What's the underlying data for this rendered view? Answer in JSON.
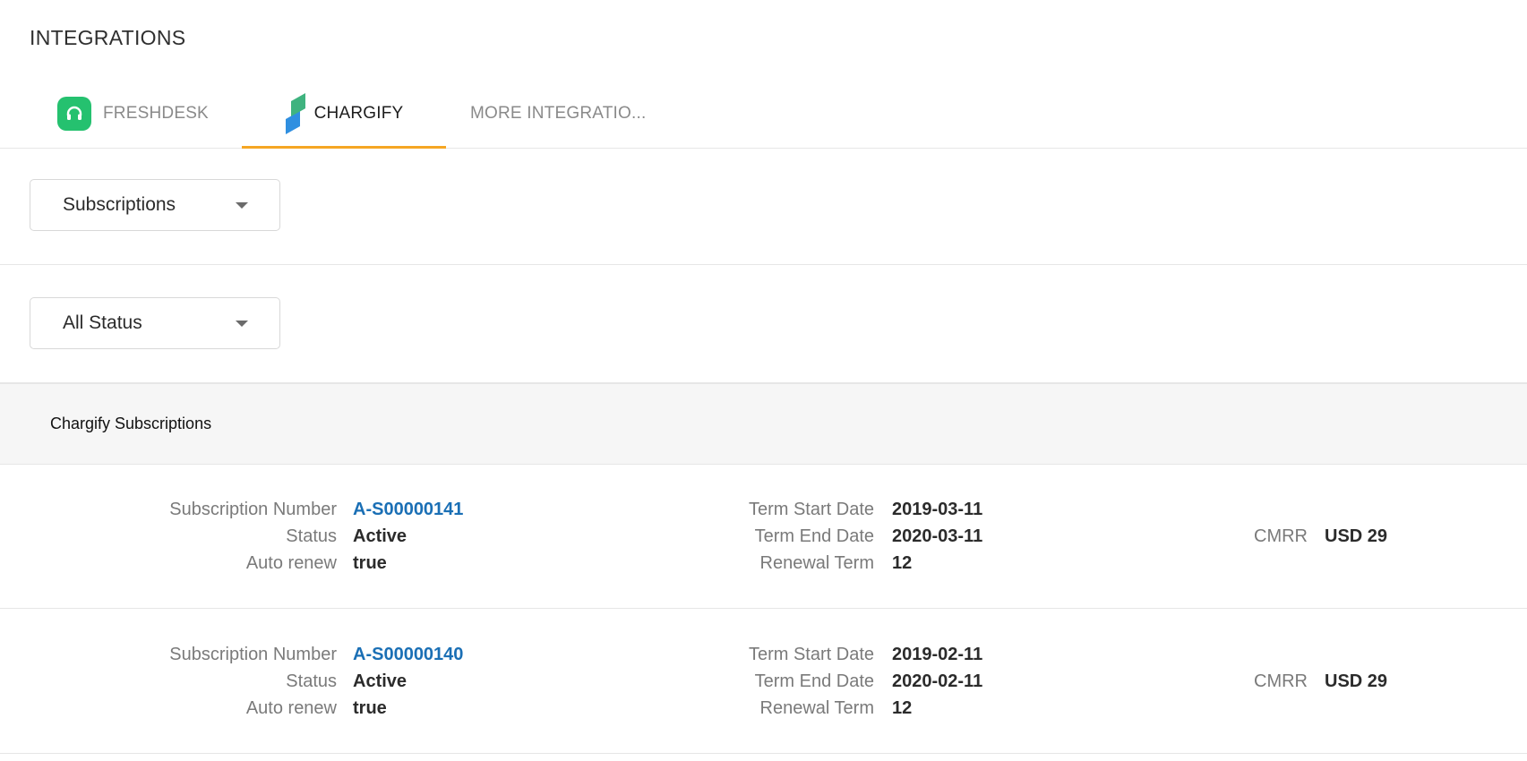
{
  "header": {
    "title": "INTEGRATIONS"
  },
  "tabs": [
    {
      "label": "FRESHDESK"
    },
    {
      "label": "CHARGIFY"
    },
    {
      "label": "MORE INTEGRATIO..."
    }
  ],
  "colors": {
    "active_tab_underline": "#f5a623",
    "link": "#1a6fb5",
    "freshdesk": "#25c16f"
  },
  "filters": {
    "type_select": {
      "value": "Subscriptions",
      "icon": "chevron-down-icon"
    },
    "status_select": {
      "value": "All Status",
      "icon": "chevron-down-icon"
    }
  },
  "list": {
    "title": "Chargify Subscriptions",
    "labels": {
      "subscription_number": "Subscription Number",
      "status": "Status",
      "auto_renew": "Auto renew",
      "term_start": "Term Start Date",
      "term_end": "Term End Date",
      "renewal_term": "Renewal Term",
      "cmrr": "CMRR"
    },
    "subscriptions": [
      {
        "number": "A-S00000141",
        "status": "Active",
        "auto_renew": "true",
        "term_start": "2019-03-11",
        "term_end": "2020-03-11",
        "renewal_term": "12",
        "cmrr": "USD 29"
      },
      {
        "number": "A-S00000140",
        "status": "Active",
        "auto_renew": "true",
        "term_start": "2019-02-11",
        "term_end": "2020-02-11",
        "renewal_term": "12",
        "cmrr": "USD 29"
      }
    ]
  }
}
